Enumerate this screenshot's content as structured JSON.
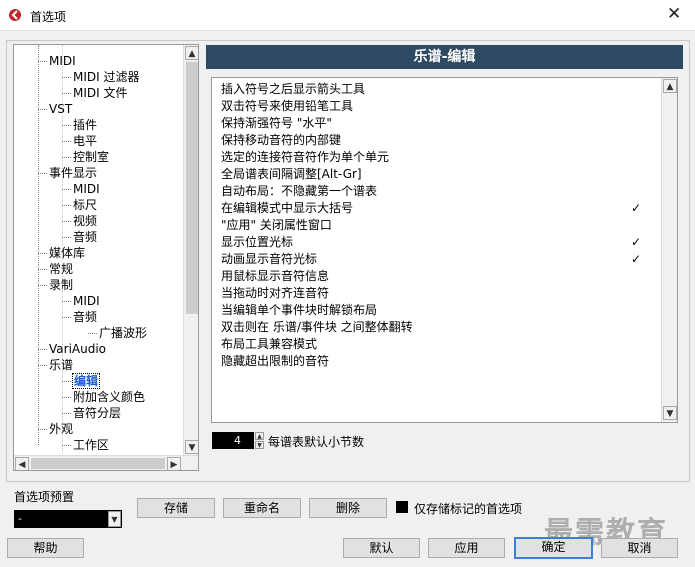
{
  "window": {
    "title": "首选项"
  },
  "tree": {
    "items": [
      {
        "label": "MIDI",
        "level": 1
      },
      {
        "label": "MIDI 过滤器",
        "level": 2
      },
      {
        "label": "MIDI 文件",
        "level": 2
      },
      {
        "label": "VST",
        "level": 1
      },
      {
        "label": "插件",
        "level": 2
      },
      {
        "label": "电平",
        "level": 2
      },
      {
        "label": "控制室",
        "level": 2
      },
      {
        "label": "事件显示",
        "level": 1
      },
      {
        "label": "MIDI",
        "level": 2
      },
      {
        "label": "标尺",
        "level": 2
      },
      {
        "label": "视频",
        "level": 2
      },
      {
        "label": "音频",
        "level": 2
      },
      {
        "label": "媒体库",
        "level": 1
      },
      {
        "label": "常规",
        "level": 1
      },
      {
        "label": "录制",
        "level": 1
      },
      {
        "label": "MIDI",
        "level": 2
      },
      {
        "label": "音频",
        "level": 2
      },
      {
        "label": "广播波形",
        "level": 3
      },
      {
        "label": "VariAudio",
        "level": 1
      },
      {
        "label": "乐谱",
        "level": 1
      },
      {
        "label": "编辑",
        "level": 2,
        "selected": true
      },
      {
        "label": "附加含义颜色",
        "level": 2
      },
      {
        "label": "音符分层",
        "level": 2
      },
      {
        "label": "外观",
        "level": 1
      },
      {
        "label": "工作区",
        "level": 2
      }
    ]
  },
  "section": {
    "title": "乐谱-编辑"
  },
  "options": [
    {
      "label": "插入符号之后显示箭头工具",
      "checked": false
    },
    {
      "label": "双击符号来使用铅笔工具",
      "checked": false
    },
    {
      "label": "保持渐强符号 \"水平\"",
      "checked": false
    },
    {
      "label": "保持移动音符的内部键",
      "checked": false
    },
    {
      "label": "选定的连接符音符作为单个单元",
      "checked": false
    },
    {
      "label": "全局谱表间隔调整[Alt-Gr]",
      "checked": false
    },
    {
      "label": "自动布局：不隐藏第一个谱表",
      "checked": false
    },
    {
      "label": "在编辑模式中显示大括号",
      "checked": true
    },
    {
      "label": "\"应用\" 关闭属性窗口",
      "checked": false
    },
    {
      "label": "显示位置光标",
      "checked": true
    },
    {
      "label": "动画显示音符光标",
      "checked": true
    },
    {
      "label": "用鼠标显示音符信息",
      "checked": false
    },
    {
      "label": "当拖动时对齐连音符",
      "checked": false
    },
    {
      "label": "当编辑单个事件块时解锁布局",
      "checked": false
    },
    {
      "label": "双击则在 乐谱/事件块 之间整体翻转",
      "checked": false
    },
    {
      "label": "布局工具兼容模式",
      "checked": false
    },
    {
      "label": "隐藏超出限制的音符",
      "checked": false
    }
  ],
  "check_mark": "✓",
  "bars_per_staff": {
    "value": "4",
    "label": "每谱表默认小节数"
  },
  "presets": {
    "label": "首选项预置",
    "selected": "-",
    "store_label": "存储",
    "rename_label": "重命名",
    "delete_label": "删除",
    "store_marked_only_label": "仅存储标记的首选项"
  },
  "footer": {
    "help_label": "帮助",
    "default_label": "默认",
    "apply_label": "应用",
    "ok_label": "确定",
    "cancel_label": "取消"
  },
  "watermark": "最需教育",
  "colors": {
    "header_bg": "#2d4a62",
    "focus_border": "#3b7fd6"
  }
}
